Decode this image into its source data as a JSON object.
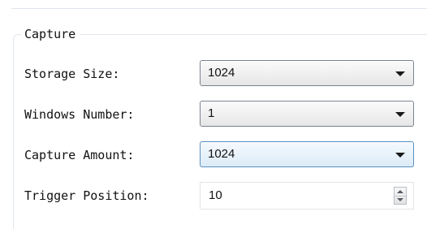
{
  "capture_group": {
    "title": "Capture",
    "storage_size": {
      "label": "Storage Size:",
      "value": "1024"
    },
    "windows_number": {
      "label": "Windows Number:",
      "value": "1"
    },
    "capture_amount": {
      "label": "Capture Amount:",
      "value": "1024"
    },
    "trigger_position": {
      "label": "Trigger Position:",
      "value": "10"
    }
  },
  "icons": {
    "dropdown": "chevron-down-icon",
    "spin_up": "spin-up-icon",
    "spin_down": "spin-down-icon"
  },
  "colors": {
    "focus_border": "#5a8fc2",
    "group_border": "#dfe6ee"
  }
}
